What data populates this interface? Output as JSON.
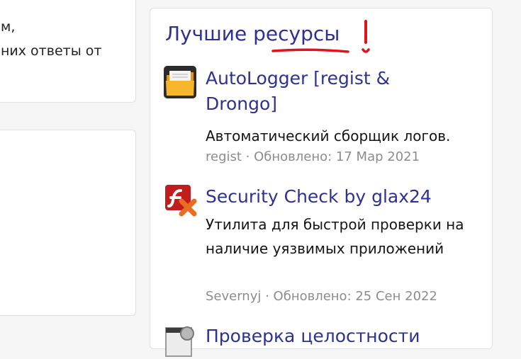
{
  "left_column": {
    "line1": "м,",
    "line2": "них ответы от"
  },
  "sidebar": {
    "title": "Лучшие ресурсы",
    "annotation_color": "#e0131b",
    "resources": [
      {
        "icon": "folder-icon",
        "title": "AutoLogger [regist & Drongo]",
        "description": "Автоматический сборщик логов.",
        "author": "regist",
        "separator": " · ",
        "updated": "Обновлено: 17 Мар 2021"
      },
      {
        "icon": "flash-x-icon",
        "title": "Security Check by glax24",
        "description": "Утилита для быстрой проверки на наличие уязвимых приложений",
        "author": "Severnyj",
        "separator": " · ",
        "updated": "Обновлено: 25 Сен 2022"
      },
      {
        "icon": "system-file-icon",
        "title": "Проверка целостности"
      }
    ]
  },
  "colors": {
    "link": "#2e3192",
    "meta": "#8c8c8c",
    "text": "#141414",
    "border": "#dfe0e3"
  }
}
